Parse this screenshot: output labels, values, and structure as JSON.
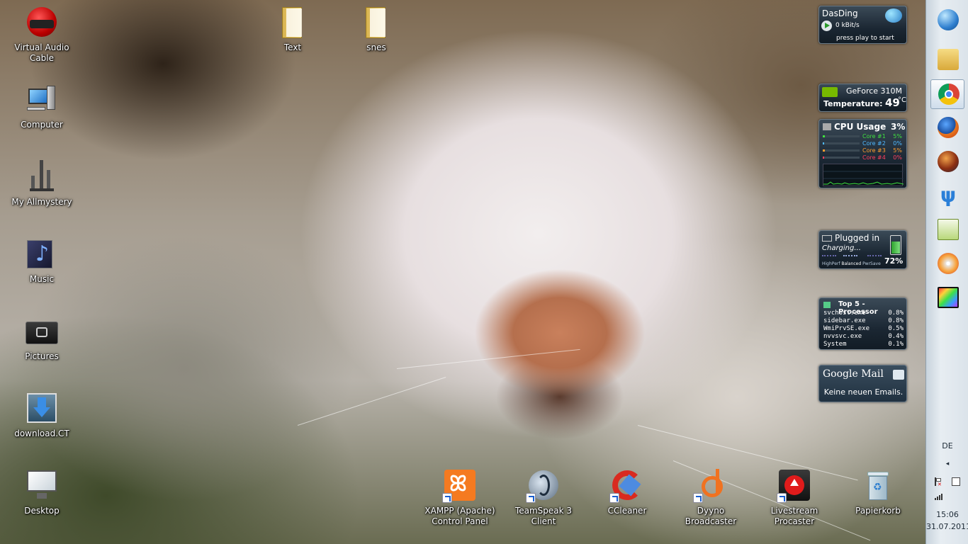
{
  "desktop_icons_left": [
    {
      "label": "Virtual Audio Cable"
    },
    {
      "label": "Computer"
    },
    {
      "label": "My Allmystery"
    },
    {
      "label": "Music"
    },
    {
      "label": "Pictures"
    },
    {
      "label": "download.CT"
    },
    {
      "label": "Desktop"
    }
  ],
  "desktop_icons_top": [
    {
      "label": "Text"
    },
    {
      "label": "snes"
    }
  ],
  "desktop_icons_bottom": [
    {
      "label": "XAMPP (Apache) Control Panel"
    },
    {
      "label": "TeamSpeak 3 Client"
    },
    {
      "label": "CCleaner"
    },
    {
      "label": "Dyyno Broadcaster"
    },
    {
      "label": "Livestream Procaster"
    },
    {
      "label": "Papierkorb"
    }
  ],
  "gadgets": {
    "radio": {
      "station": "DasDing",
      "bitrate": "0 kBit/s",
      "hint": "press play to start"
    },
    "gpu": {
      "name": "GeForce 310M",
      "temp_label": "Temperature:",
      "temp_value": "49",
      "temp_unit": "°C"
    },
    "cpu": {
      "title": "CPU Usage",
      "total": "3%",
      "cores": [
        {
          "label": "Core #1",
          "value": "5%",
          "level": 0.05,
          "color": "#3fe03f"
        },
        {
          "label": "Core #2",
          "value": "0%",
          "level": 0.0,
          "color": "#4fb8ff"
        },
        {
          "label": "Core #3",
          "value": "5%",
          "level": 0.05,
          "color": "#ff9e2e"
        },
        {
          "label": "Core #4",
          "value": "0%",
          "level": 0.0,
          "color": "#ff3f5f"
        }
      ]
    },
    "battery": {
      "title": "Plugged in",
      "status": "Charging...",
      "percent": "72%",
      "level": 0.72,
      "plans": [
        "HighPerf",
        "Balanced",
        "PwrSave"
      ]
    },
    "top5": {
      "title": "Top 5 - Processor",
      "rows": [
        {
          "name": "svchost.exe",
          "value": "0.8%"
        },
        {
          "name": "sidebar.exe",
          "value": "0.8%"
        },
        {
          "name": "WmiPrvSE.exe",
          "value": "0.5%"
        },
        {
          "name": "nvvsvc.exe",
          "value": "0.4%"
        },
        {
          "name": "System",
          "value": "0.1%"
        }
      ]
    },
    "mail": {
      "title": "Google Mail",
      "message": "Keine neuen Emails."
    }
  },
  "taskbar": {
    "apps": [
      "start-orb",
      "explorer",
      "chrome",
      "firefox",
      "thunderbird",
      "vuze",
      "notepad-plus-plus",
      "nero",
      "video-editor"
    ],
    "language": "DE",
    "time": "15:06",
    "date": "31.07.2011"
  }
}
